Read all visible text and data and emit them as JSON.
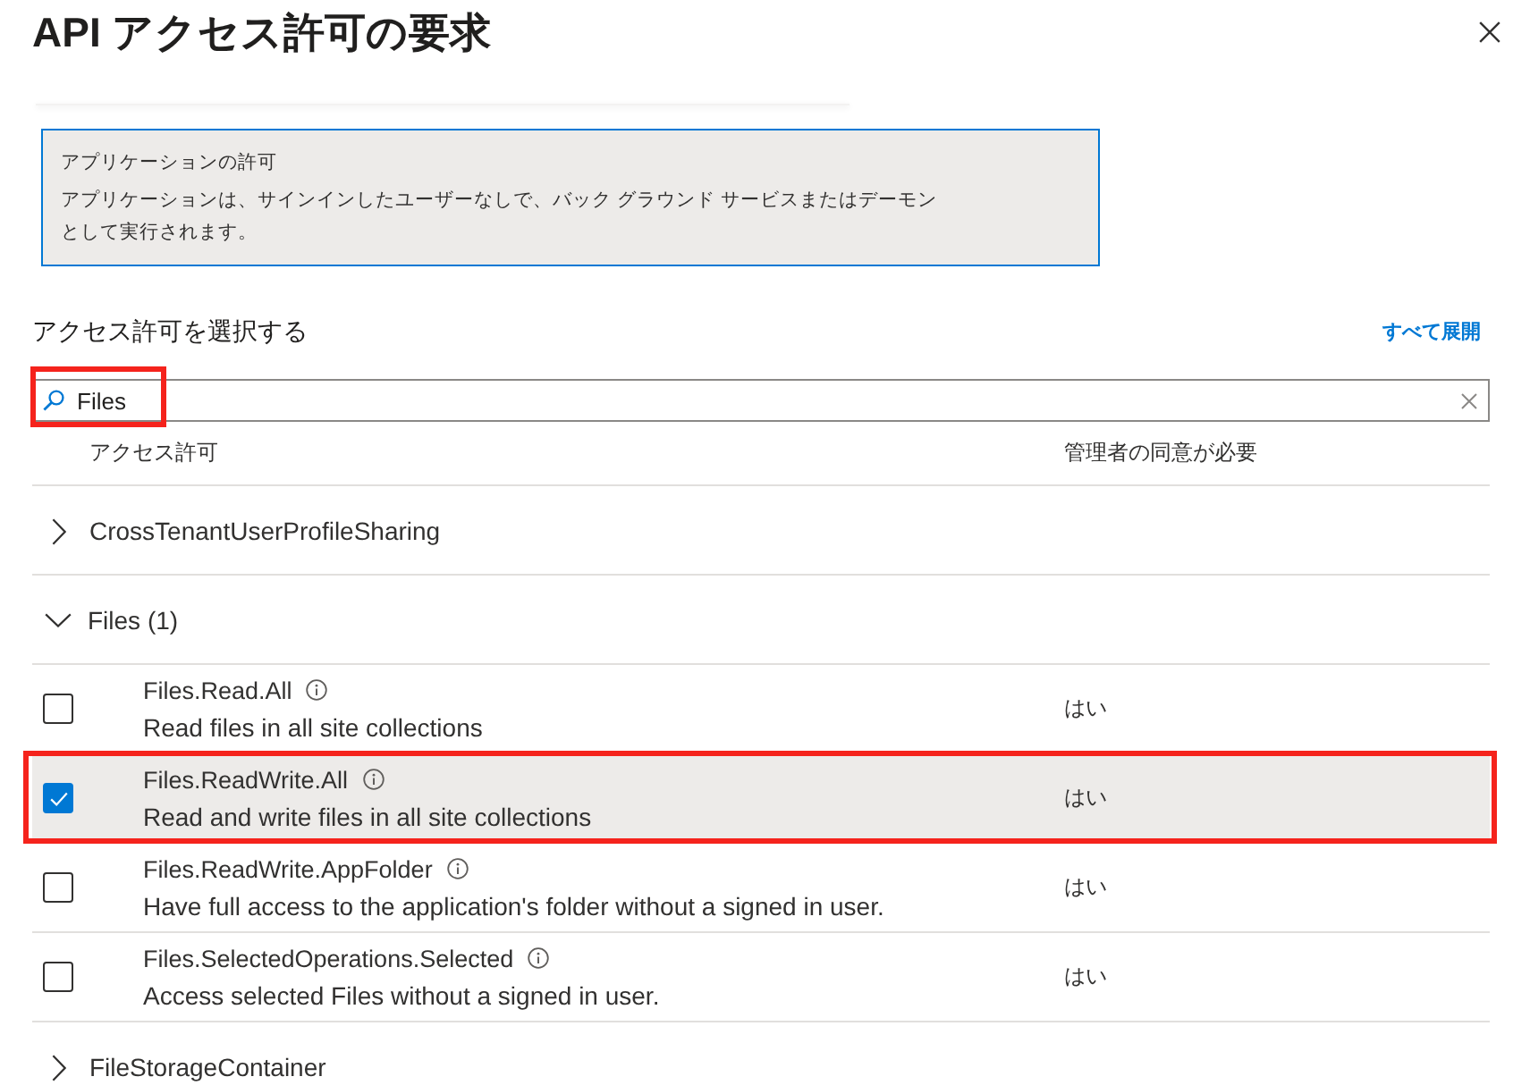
{
  "window": {
    "title": "API アクセス許可の要求"
  },
  "notice": {
    "title": "アプリケーションの許可",
    "text": "アプリケーションは、サインインしたユーザーなしで、バック グラウンド サービスまたはデーモンとして実行されます。"
  },
  "section": {
    "title": "アクセス許可を選択する",
    "expand_all": "すべて展開"
  },
  "search": {
    "value": "Files",
    "highlighted": true
  },
  "table": {
    "columns": [
      "アクセス許可",
      "管理者の同意が必要"
    ],
    "groups": [
      {
        "label": "CrossTenantUserProfileSharing",
        "expanded": false
      },
      {
        "label": "Files (1)",
        "expanded": true,
        "permissions": [
          {
            "name": "Files.Read.All",
            "description": "Read files in all site collections",
            "admin_consent": "はい",
            "checked": false,
            "highlighted": false
          },
          {
            "name": "Files.ReadWrite.All",
            "description": "Read and write files in all site collections",
            "admin_consent": "はい",
            "checked": true,
            "highlighted": true
          },
          {
            "name": "Files.ReadWrite.AppFolder",
            "description": "Have full access to the application's folder without a signed in user.",
            "admin_consent": "はい",
            "checked": false,
            "highlighted": false
          },
          {
            "name": "Files.SelectedOperations.Selected",
            "description": "Access selected Files without a signed in user.",
            "admin_consent": "はい",
            "checked": false,
            "highlighted": false
          }
        ]
      },
      {
        "label": "FileStorageContainer",
        "expanded": false
      }
    ]
  }
}
